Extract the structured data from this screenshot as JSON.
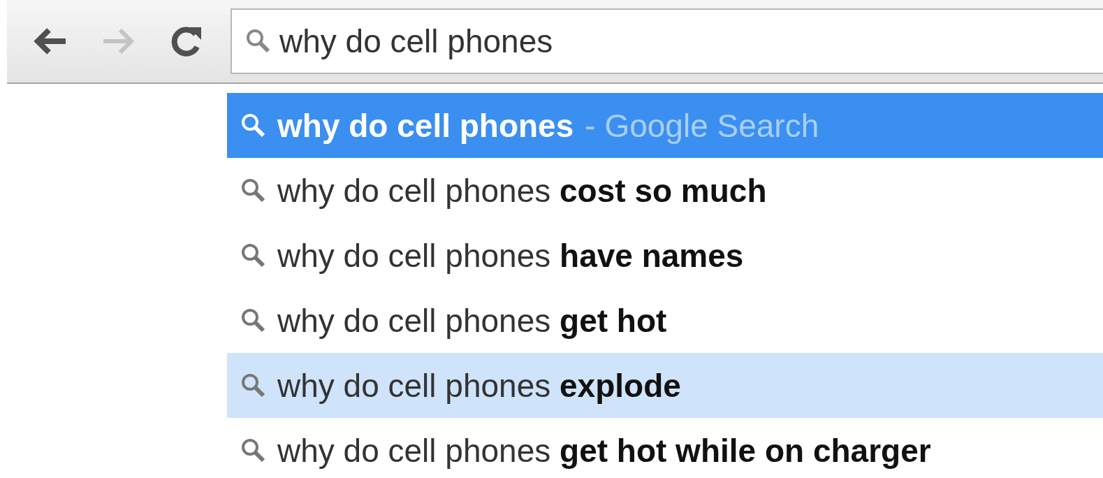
{
  "toolbar": {
    "back": {
      "disabled": false
    },
    "forward": {
      "disabled": true
    },
    "address": {
      "value": "why do cell phones"
    }
  },
  "suggestions": [
    {
      "kind": "typed",
      "text": "why do cell phones",
      "suffix": "- Google Search",
      "selected": true,
      "hovered": false
    },
    {
      "kind": "suggest",
      "text": "why do cell phones **cost so much**",
      "selected": false,
      "hovered": false
    },
    {
      "kind": "suggest",
      "text": "why do cell phones **have names**",
      "selected": false,
      "hovered": false
    },
    {
      "kind": "suggest",
      "text": "why do cell phones **get hot**",
      "selected": false,
      "hovered": false
    },
    {
      "kind": "suggest",
      "text": "why do cell phones **explode**",
      "selected": false,
      "hovered": true
    },
    {
      "kind": "suggest",
      "text": "why do cell phones **get hot while on charger**",
      "selected": false,
      "hovered": false
    }
  ]
}
